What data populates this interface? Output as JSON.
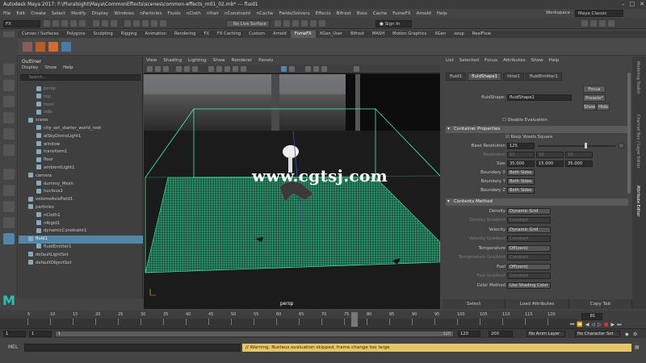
{
  "titlebar": {
    "text": "Autodesk Maya 2017: F:\\Pluralsight\\Maya\\CommonEffects\\scenes\\common-effects_m01_02.mb* --- fluid1"
  },
  "menubar": [
    "File",
    "Edit",
    "Create",
    "Select",
    "Modify",
    "Display",
    "Windows",
    "nParticles",
    "Fluids",
    "nCloth",
    "nHair",
    "nConstraint",
    "nCache",
    "Fields/Solvers",
    "Effects",
    "Bifrost",
    "Boss",
    "Cache",
    "FumeFX",
    "Arnold",
    "Help"
  ],
  "statusline": {
    "mode": "FX",
    "live_surface": "No Live Surface",
    "sign_in": "Sign In"
  },
  "workspace": {
    "label": "Workspace :",
    "value": "Maya Classic"
  },
  "shelf_tabs": [
    "Curves / Surfaces",
    "Polygons",
    "Sculpting",
    "Rigging",
    "Animation",
    "Rendering",
    "FX",
    "FX Caching",
    "Custom",
    "Arnold",
    "FumeFX",
    "XGen_User",
    "Bifrost",
    "MASH",
    "Motion Graphics",
    "XGen",
    "soup",
    "RealFlow"
  ],
  "shelf_active": "FumeFX",
  "outliner": {
    "title": "Outliner",
    "menu": [
      "Display",
      "Show",
      "Help"
    ],
    "search_placeholder": "Search...",
    "items": [
      {
        "label": "persp",
        "indent": 1,
        "dim": true
      },
      {
        "label": "top",
        "indent": 1,
        "dim": true
      },
      {
        "label": "front",
        "indent": 1,
        "dim": true
      },
      {
        "label": "side",
        "indent": 1,
        "dim": true
      },
      {
        "label": "scene",
        "indent": 0
      },
      {
        "label": "city_set_starter_world_root",
        "indent": 1
      },
      {
        "label": "aiSkyDomeLight1",
        "indent": 1
      },
      {
        "label": "window",
        "indent": 1
      },
      {
        "label": "transform1",
        "indent": 1
      },
      {
        "label": "floor",
        "indent": 1
      },
      {
        "label": "ambientLight1",
        "indent": 1
      },
      {
        "label": "camera",
        "indent": 0
      },
      {
        "label": "dummy_Mesh",
        "indent": 1
      },
      {
        "label": "nucleus1",
        "indent": 1
      },
      {
        "label": "volumeAxisField1",
        "indent": 0
      },
      {
        "label": "particles",
        "indent": 0
      },
      {
        "label": "nCloth1",
        "indent": 1
      },
      {
        "label": "nRigid1",
        "indent": 1
      },
      {
        "label": "dynamicConstraint1",
        "indent": 1
      },
      {
        "label": "fluid1",
        "indent": 0,
        "selected": true
      },
      {
        "label": "fluidEmitter1",
        "indent": 1
      },
      {
        "label": "defaultLightSet",
        "indent": 0
      },
      {
        "label": "defaultObjectSet",
        "indent": 0
      }
    ]
  },
  "viewport": {
    "menu": [
      "View",
      "Shading",
      "Lighting",
      "Show",
      "Renderer",
      "Panels"
    ],
    "camera_label": "persp",
    "watermark": "www.cgtsj.com"
  },
  "attribute_editor": {
    "menu": [
      "List",
      "Selected",
      "Focus",
      "Attributes",
      "Show",
      "Help"
    ],
    "tabs": [
      "fluid1",
      "fluidShape1",
      "time1",
      "fluidEmitter1"
    ],
    "active_tab": "fluidShape1",
    "shape_label": "fluidShape:",
    "shape_value": "fluidShape1",
    "focus_btn": "Focus",
    "presets_btn": "Presets*",
    "show_btn": "Show",
    "hide_btn": "Hide",
    "disable_eval": "Disable Evaluation",
    "container_section": "Container Properties",
    "keep_voxels": "Keep Voxels Square",
    "base_res_label": "Base Resolution",
    "base_res_value": "125",
    "resolution_label": "Resolution",
    "resolution_values": [
      "10",
      "10",
      "10"
    ],
    "size_label": "Size",
    "size_values": [
      "35.000",
      "15.000",
      "35.000"
    ],
    "boundary_x_label": "Boundary X",
    "boundary_x": "Both Sides",
    "boundary_y_label": "Boundary Y",
    "boundary_y": "Both Sides",
    "boundary_z_label": "Boundary Z",
    "boundary_z": "Both Sides",
    "contents_section": "Contents Method",
    "density_label": "Density",
    "density": "Dynamic Grid",
    "density_grad_label": "Density Gradient",
    "density_grad": "Constant",
    "velocity_label": "Velocity",
    "velocity": "Dynamic Grid",
    "velocity_grad_label": "Velocity Gradient",
    "velocity_grad": "Constant",
    "temperature_label": "Temperature",
    "temperature": "Off(zero)",
    "temp_grad_label": "Temperature Gradient",
    "temp_grad": "Constant",
    "fuel_label": "Fuel",
    "fuel": "Off(zero)",
    "fuel_grad_label": "Fuel Gradient",
    "fuel_grad": "Constant",
    "color_method_label": "Color Method",
    "color_method": "Use Shading Color",
    "bottom_buttons": [
      "Select",
      "Load Attributes",
      "Copy Tab"
    ]
  },
  "side_tabs": [
    "Modeling Toolkit",
    "Channel Box / Layer Editor",
    "Attribute Editor"
  ],
  "timeline": {
    "ticks": [
      "5",
      "10",
      "15",
      "20",
      "25",
      "30",
      "35",
      "40",
      "45",
      "50",
      "55",
      "60",
      "65",
      "70",
      "75",
      "80",
      "85",
      "90",
      "95",
      "100",
      "105",
      "110",
      "115",
      "120"
    ],
    "current_frame": "81",
    "current_frame_fraction": 0.675,
    "range_start": "1",
    "range_inner_start": "1",
    "range_bar_start": "1",
    "range_bar_end": "120",
    "range_inner_end": "120",
    "range_end": "200",
    "anim_layer": "No Anim Layer",
    "char_set": "No Character Set"
  },
  "command": {
    "label": "MEL",
    "warning": "// Warning: Nucleus evaluation skipped, frame change too large"
  },
  "colors": {
    "grid_green": "#34d394",
    "viewport_bg": "#1b1b1b",
    "selection_blue": "#5285a6",
    "warning_yellow": "#e5c66a",
    "maya_teal": "#26c5b6"
  }
}
